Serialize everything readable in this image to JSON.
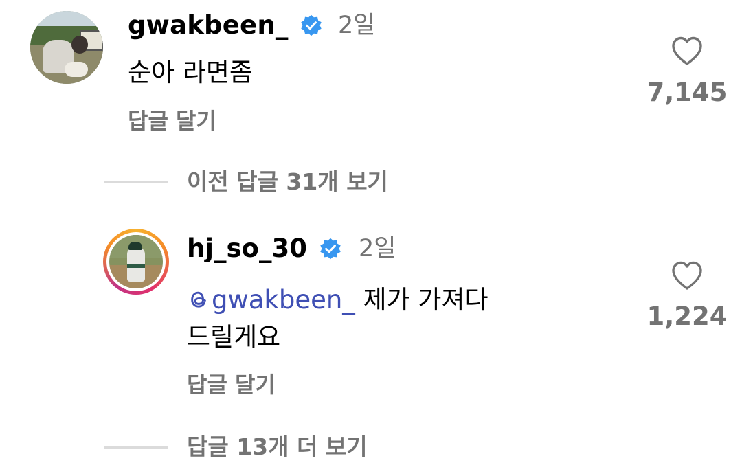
{
  "comment": {
    "username": "gwakbeen_",
    "time": "2일",
    "text": "순아 라면좀",
    "reply_label": "답글 달기",
    "likes": "7,145"
  },
  "view_previous": "이전 답글 31개 보기",
  "reply": {
    "username": "hj_so_30",
    "time": "2일",
    "mention": "gwakbeen_",
    "text": "제가 가져다드릴게요",
    "reply_label": "답글 달기",
    "likes": "1,224"
  },
  "view_more": "답글 13개 더 보기",
  "colors": {
    "verified": "#3897f0",
    "mention": "#3f4fb4",
    "secondary_text": "#737373",
    "divider": "#dbdbdb"
  },
  "icons": {
    "verified": "verified-badge-icon",
    "like": "heart-icon",
    "mention": "threads-icon"
  }
}
